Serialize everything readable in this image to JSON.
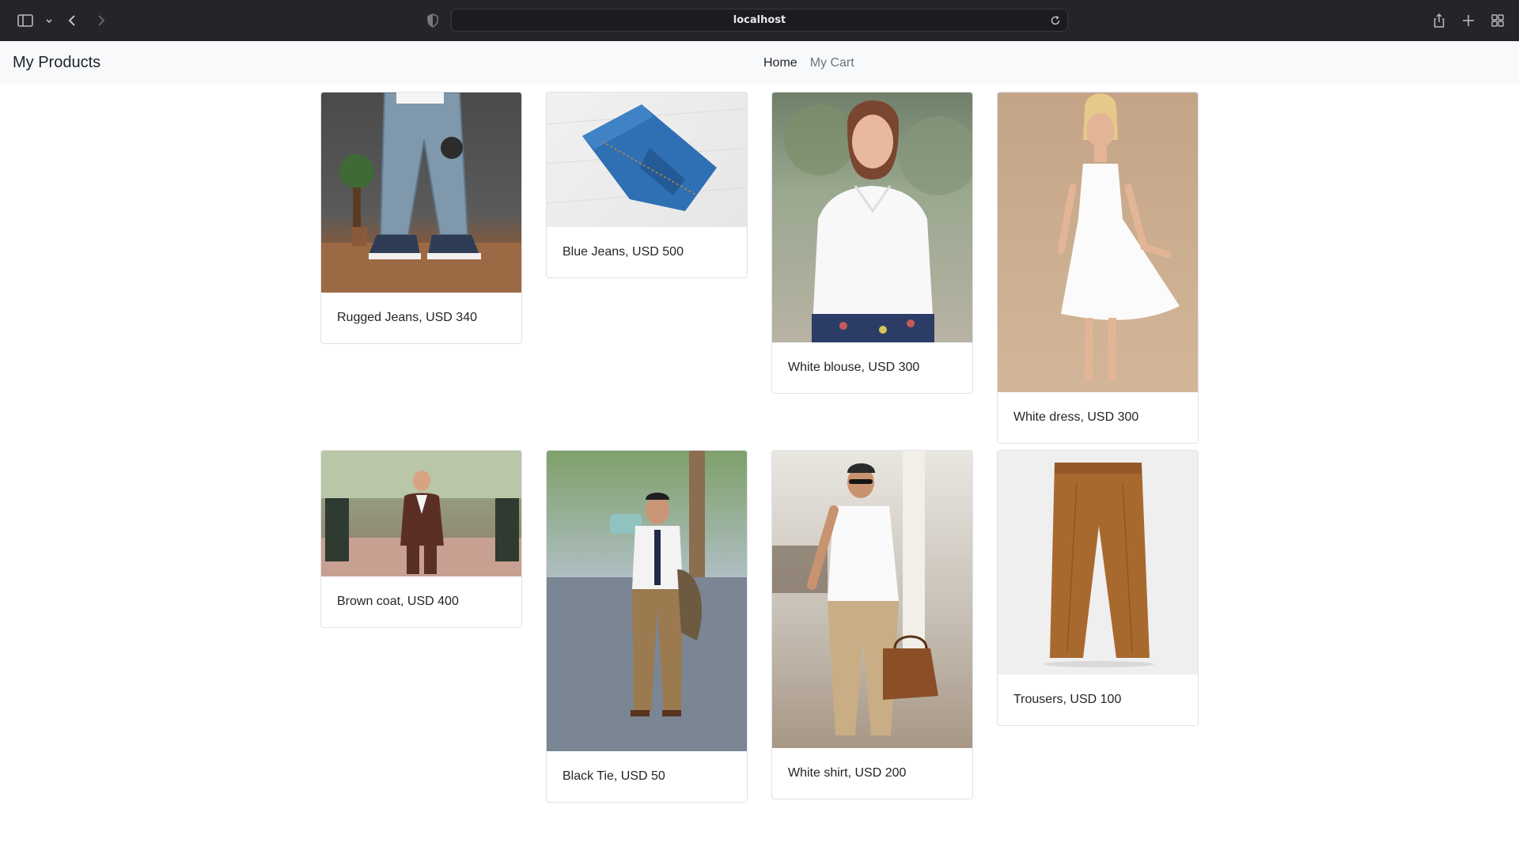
{
  "browser": {
    "url": "localhost",
    "icons": [
      "sidebar-toggle-icon",
      "chevron-down-icon",
      "back-icon",
      "forward-icon",
      "privacy-shield-icon",
      "reload-icon",
      "share-icon",
      "new-tab-icon",
      "tab-overview-icon"
    ]
  },
  "navbar": {
    "brand": "My Products",
    "links": [
      "Home",
      "My Cart"
    ]
  },
  "products": [
    {
      "caption": "Rugged Jeans, USD 340",
      "image": "rugged-jeans-photo"
    },
    {
      "caption": "Blue Jeans, USD 500",
      "image": "blue-jeans-photo"
    },
    {
      "caption": "White blouse, USD 300",
      "image": "white-blouse-photo"
    },
    {
      "caption": "White dress, USD 300",
      "image": "white-dress-photo"
    },
    {
      "caption": "Brown coat, USD 400",
      "image": "brown-coat-photo"
    },
    {
      "caption": "Black Tie, USD 50",
      "image": "black-tie-photo"
    },
    {
      "caption": "White shirt, USD 200",
      "image": "white-shirt-photo"
    },
    {
      "caption": "Trousers, USD 100",
      "image": "trousers-photo"
    }
  ]
}
